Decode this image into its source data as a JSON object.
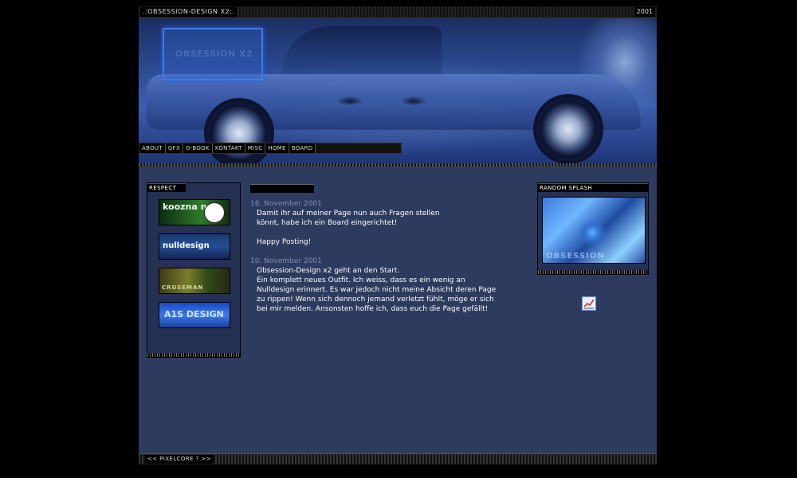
{
  "topbar": {
    "title": ".:OBSESSION-DESIGN X2:.",
    "year": "2001"
  },
  "header": {
    "logo_text": "OBSESSION X2"
  },
  "nav": {
    "items": [
      "ABOUT",
      "GFX",
      "G-BOOK",
      "KONTAKT",
      "MISC",
      "HOME",
      "BOARD"
    ]
  },
  "respect": {
    "title": "RESPECT",
    "banners": [
      "koozna nr.8",
      "nulldesign",
      "CRUSEMAN",
      "A1S DESIGN"
    ]
  },
  "news": [
    {
      "date": "16. November 2001",
      "text": "Damit ihr auf meiner Page nun auch Fragen stellen\nkönnt, habe ich ein Board eingerichtet!\n\nHappy Posting!"
    },
    {
      "date": "10. November 2001",
      "text": "Obsession-Design x2 geht an den Start.\nEin komplett neues Outfit. Ich weiss, dass es ein wenig an\nNulldesign erinnert. Es war jedoch nicht meine Absicht deren Page\nzu rippen! Wenn sich dennoch jemand verletzt fühlt, möge er sich\nbei mir melden. Ansonsten hoffe ich, dass euch die Page gefällt!"
    }
  ],
  "splash": {
    "title": "RANDOM SPLASH",
    "image_text": "OBSESSION"
  },
  "footer": {
    "text": "<< PIXELCORE ? >>"
  }
}
